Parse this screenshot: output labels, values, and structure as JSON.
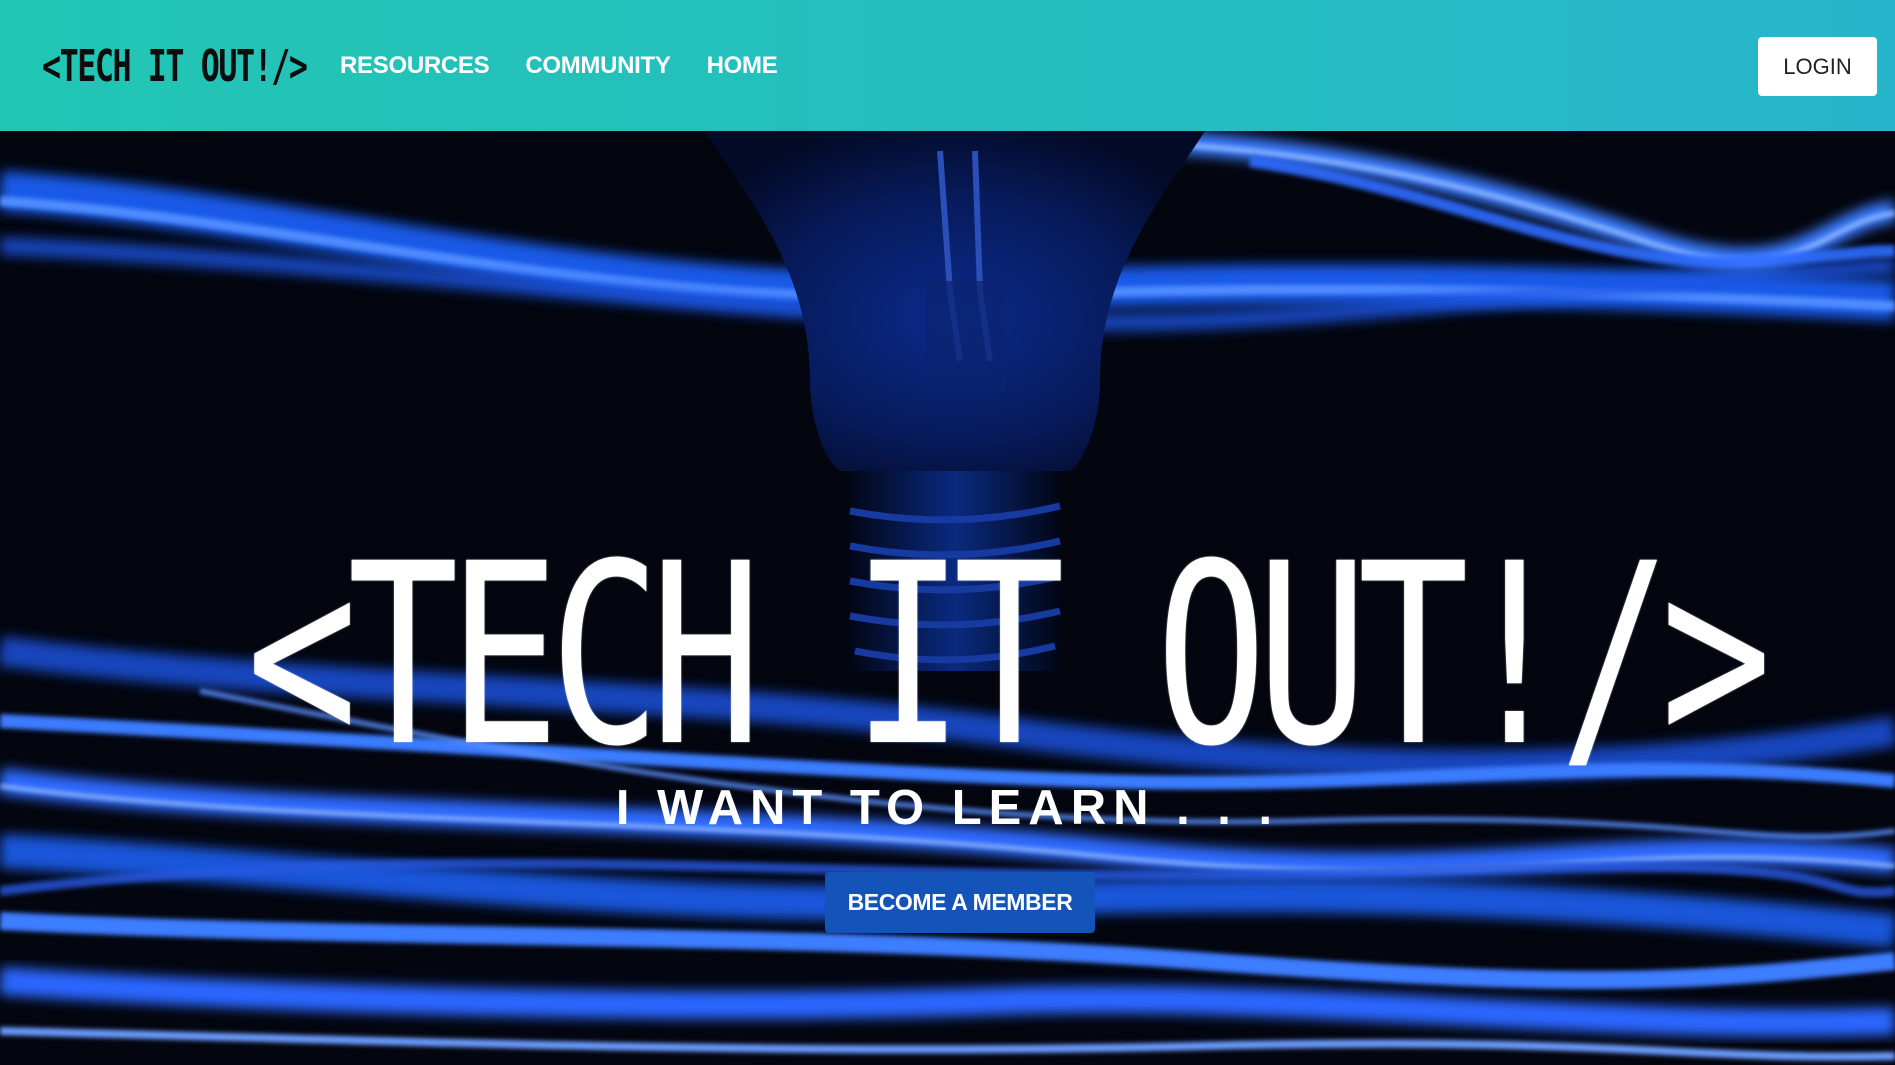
{
  "navbar": {
    "brand": "<TECH IT OUT!/>",
    "links": [
      {
        "label": "RESOURCES"
      },
      {
        "label": "COMMUNITY"
      },
      {
        "label": "HOME"
      }
    ],
    "login_label": "LOGIN",
    "gradient_colors": [
      "#22c6b4",
      "#26b6cb"
    ]
  },
  "hero": {
    "title": "<TECH IT OUT!/>",
    "subtitle": "I WANT TO LEARN . . .",
    "cta_label": "BECOME A MEMBER",
    "cta_color": "#1453b8",
    "background_icon": "lightbulb-with-blue-light-trails"
  }
}
